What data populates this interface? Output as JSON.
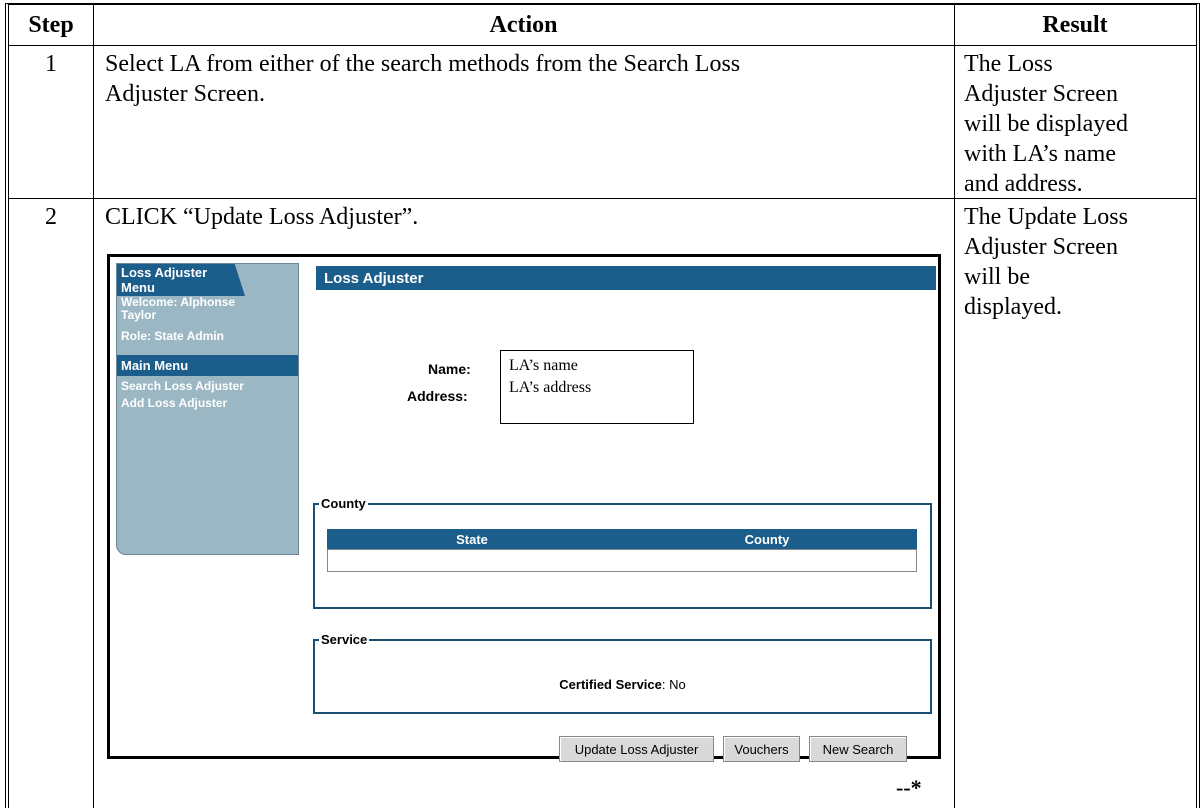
{
  "table": {
    "headers": {
      "step": "Step",
      "action": "Action",
      "result": "Result"
    },
    "rows": [
      {
        "step": "1",
        "action_lines": [
          "Select LA from either of the search methods from the Search Loss",
          "Adjuster Screen."
        ],
        "result_lines": [
          "The Loss",
          "Adjuster Screen",
          "will be displayed",
          "with LA’s name",
          "and address."
        ]
      },
      {
        "step": "2",
        "action": "CLICK “Update Loss Adjuster”.",
        "result_lines": [
          "The Update Loss",
          "Adjuster Screen",
          "will be",
          "displayed."
        ]
      }
    ],
    "end_marker": "--*"
  },
  "screenshot": {
    "sidebar": {
      "menu_title": "Loss Adjuster Menu",
      "welcome_line1": "Welcome: Alphonse",
      "welcome_line2": "Taylor",
      "role": "Role: State Admin",
      "main_menu": "Main Menu",
      "items": [
        "Search Loss Adjuster",
        "Add Loss Adjuster"
      ]
    },
    "header_title": "Loss Adjuster",
    "name_label": "Name:",
    "address_label": "Address:",
    "popup_name": "LA’s name",
    "popup_address": "LA’s address",
    "county_legend": "County",
    "county_columns": [
      "State",
      "County"
    ],
    "service_legend": "Service",
    "certified_label": "Certified Service",
    "certified_value": ": No",
    "buttons": [
      "Update Loss Adjuster",
      "Vouchers",
      "New Search"
    ]
  },
  "colors": {
    "header_blue": "#1b5e8c",
    "sidebar_bg": "#9bb7c4"
  }
}
